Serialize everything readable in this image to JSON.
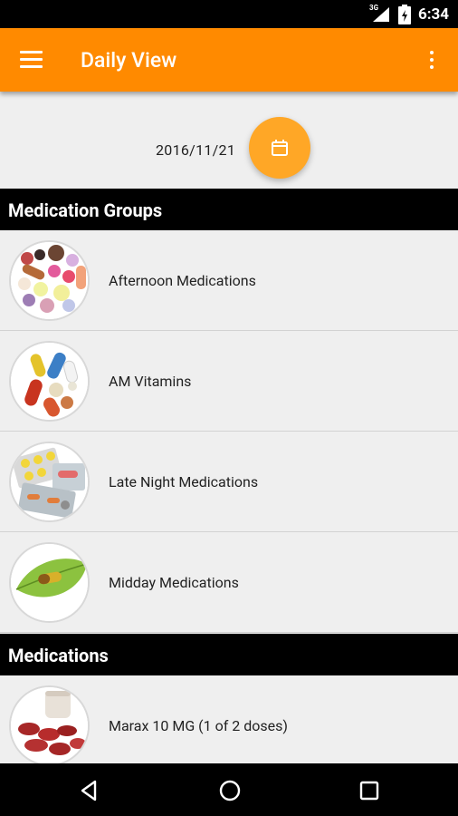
{
  "status_bar": {
    "network": "3G",
    "time": "6:34"
  },
  "app_bar": {
    "title": "Daily View"
  },
  "date_selector": {
    "date": "2016/11/21"
  },
  "sections": {
    "groups_title": "Medication Groups",
    "meds_title": "Medications"
  },
  "groups": [
    {
      "label": "Afternoon Medications"
    },
    {
      "label": "AM Vitamins"
    },
    {
      "label": "Late Night Medications"
    },
    {
      "label": "Midday Medications"
    }
  ],
  "medications": [
    {
      "label": "Marax 10 MG (1 of 2 doses)"
    }
  ],
  "colors": {
    "accent": "#ff8a00",
    "fab": "#ffa726",
    "header_bg": "#000000"
  }
}
